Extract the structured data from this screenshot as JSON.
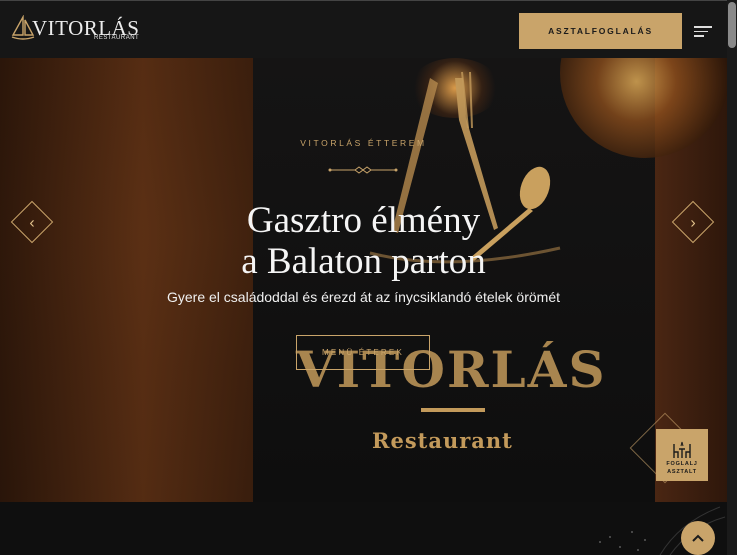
{
  "header": {
    "logo_title": "VITORLÁS",
    "logo_subtitle": "RESTAURANT",
    "cta_label": "ASZTALFOGLALÁS",
    "menu_icon": "hamburger-icon"
  },
  "hero": {
    "kicker": "VITORLÁS ÉTTEREM",
    "headline_line1": "Gasztro élmény",
    "headline_line2": "a Balaton parton",
    "subline": "Gyere el családoddal és érezd át az ínycsiklandó ételek örömét",
    "menu_button": "MENÜ ÉTEREK",
    "sign_main": "VITORLÁS",
    "sign_sub": "Restaurant",
    "prev_icon": "chevron-left-icon",
    "next_icon": "chevron-right-icon"
  },
  "booking": {
    "line1": "FOGLALJ",
    "line2": "ASZTALT",
    "icon": "table-chairs-icon"
  },
  "scroll_top_icon": "chevron-up-icon",
  "colors": {
    "accent": "#c9a46a",
    "header_bg": "#161616",
    "page_bg": "#0d0d0d"
  }
}
